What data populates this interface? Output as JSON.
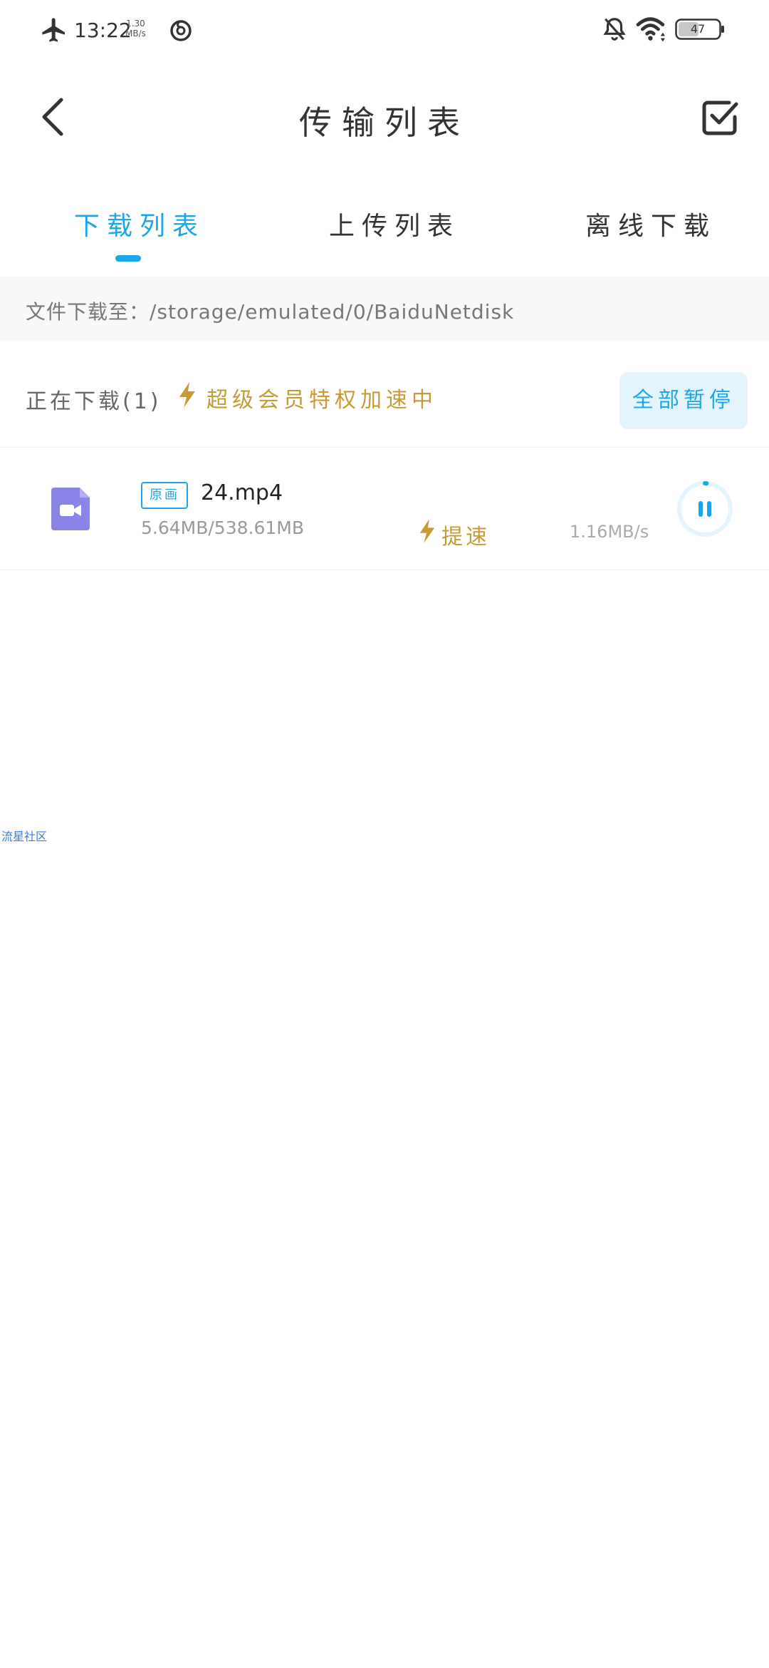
{
  "status_bar": {
    "time": "13:22",
    "net_speed_value": "1.30",
    "net_speed_unit": "MB/s",
    "battery": "47"
  },
  "nav": {
    "title": "传输列表"
  },
  "tabs": [
    {
      "label": "下载列表",
      "active": true
    },
    {
      "label": "上传列表",
      "active": false
    },
    {
      "label": "离线下载",
      "active": false
    }
  ],
  "path": {
    "text": "文件下载至：/storage/emulated/0/BaiduNetdisk"
  },
  "section": {
    "label": "正在下载(1)",
    "vip_text": "超级会员特权加速中",
    "pause_all_label": "全部暂停"
  },
  "downloads": [
    {
      "badge": "原画",
      "name": "24.mp4",
      "progress": "5.64MB/538.61MB",
      "boost_label": "提速",
      "speed": "1.16MB/s",
      "progress_fraction": 0.0105
    }
  ],
  "watermark": "流星社区",
  "colors": {
    "accent": "#1aa6e8",
    "gold": "#c79a36",
    "file_icon": "#8a84e8"
  }
}
